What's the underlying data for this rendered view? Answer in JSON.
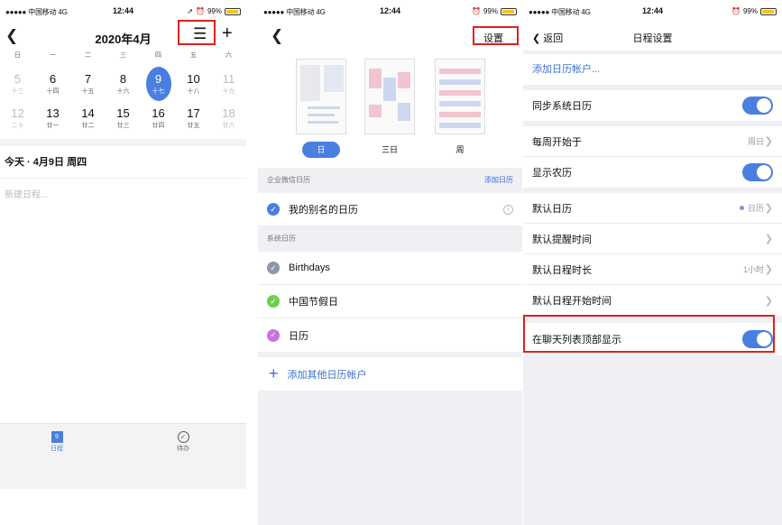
{
  "status": {
    "carrier": "●●●●● 中国移动",
    "net": "4G",
    "time": "12:44",
    "battery": "99%"
  },
  "calendar": {
    "title": "2020年4月",
    "weekdays": [
      "日",
      "一",
      "二",
      "三",
      "四",
      "五",
      "六"
    ],
    "week1": [
      {
        "n": "5",
        "l": "十三"
      },
      {
        "n": "6",
        "l": "十四"
      },
      {
        "n": "7",
        "l": "十五"
      },
      {
        "n": "8",
        "l": "十六"
      },
      {
        "n": "9",
        "l": "十七"
      },
      {
        "n": "10",
        "l": "十八"
      },
      {
        "n": "11",
        "l": "十九"
      }
    ],
    "week2": [
      {
        "n": "12",
        "l": "二十"
      },
      {
        "n": "13",
        "l": "廿一"
      },
      {
        "n": "14",
        "l": "廿二"
      },
      {
        "n": "15",
        "l": "廿三"
      },
      {
        "n": "16",
        "l": "廿四"
      },
      {
        "n": "17",
        "l": "廿五"
      },
      {
        "n": "18",
        "l": "廿六"
      }
    ],
    "today": "今天 · 4月9日 周四",
    "new_placeholder": "新建日程...",
    "tabs": [
      {
        "label": "日程",
        "icon_num": "9"
      },
      {
        "label": "待办"
      }
    ]
  },
  "settings_calendars": {
    "settings_label": "设置",
    "views": [
      "日",
      "三日",
      "周"
    ],
    "enterprise_header": "企业微信日历",
    "add_calendar": "添加日历",
    "my_calendar": "我的别名的日历",
    "system_header": "系统日历",
    "system_items": [
      {
        "label": "Birthdays",
        "color": "#8e97a8"
      },
      {
        "label": "中国节假日",
        "color": "#6ccf4d"
      },
      {
        "label": "日历",
        "color": "#c872df"
      }
    ],
    "add_other": "添加其他日历帐户"
  },
  "schedule_settings": {
    "back": "返回",
    "title": "日程设置",
    "add_account": "添加日历帐户...",
    "sync": "同步系统日历",
    "week_start": "每周开始于",
    "week_start_value": "周日",
    "lunar": "显示农历",
    "default_calendar": "默认日历",
    "default_calendar_value": "日历",
    "default_reminder": "默认提醒时间",
    "default_duration": "默认日程时长",
    "default_duration_value": "1小时",
    "default_start": "默认日程开始时间",
    "show_top": "在聊天列表顶部显示"
  },
  "colors": {
    "accent": "#4a7ee0",
    "highlight": "#e0201b"
  }
}
